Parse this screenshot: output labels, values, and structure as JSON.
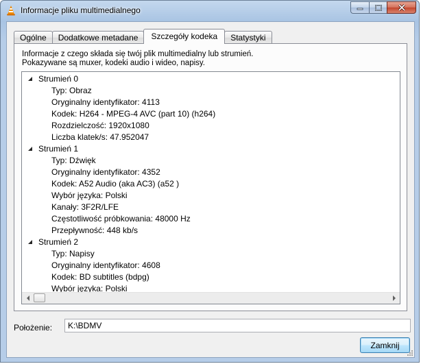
{
  "window": {
    "title": "Informacje pliku multimedialnego"
  },
  "tabs": [
    {
      "label": "Ogólne"
    },
    {
      "label": "Dodatkowe metadane"
    },
    {
      "label": "Szczegóły kodeka"
    },
    {
      "label": "Statystyki"
    }
  ],
  "active_tab": "Szczegóły kodeka",
  "description": {
    "line1": "Informacje z czego składa się twój plik multimedialny lub strumień.",
    "line2": "Pokazywane są muxer, kodeki audio i wideo, napisy."
  },
  "streams": [
    {
      "name": "Strumień 0",
      "props": [
        "Typ: Obraz",
        "Oryginalny identyfikator: 4113",
        "Kodek: H264 - MPEG-4 AVC (part 10) (h264)",
        "Rozdzielczość: 1920x1080",
        "Liczba klatek/s: 47.952047"
      ]
    },
    {
      "name": "Strumień 1",
      "props": [
        "Typ: Dźwięk",
        "Oryginalny identyfikator: 4352",
        "Kodek: A52 Audio (aka AC3) (a52 )",
        "Wybór języka: Polski",
        "Kanały: 3F2R/LFE",
        "Częstotliwość próbkowania: 48000 Hz",
        "Przepływność: 448 kb/s"
      ]
    },
    {
      "name": "Strumień 2",
      "props": [
        "Typ: Napisy",
        "Oryginalny identyfikator: 4608",
        "Kodek: BD subtitles (bdpg)",
        "Wybór języka: Polski"
      ]
    }
  ],
  "location": {
    "label": "Położenie:",
    "value": "K:\\BDMV"
  },
  "buttons": {
    "close": "Zamknij"
  },
  "colors": {
    "title_bar": "#a9c4e3",
    "close_caption": "#c2452d",
    "default_button": "#3c7fb1"
  }
}
